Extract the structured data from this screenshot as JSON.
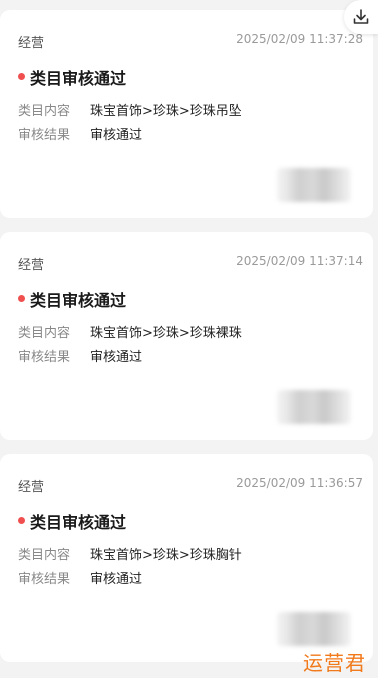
{
  "colors": {
    "status_dot": "#f04f4f",
    "watermark": "#f07a1c"
  },
  "download_button": {
    "icon": "download-icon"
  },
  "cards": [
    {
      "category": "经营",
      "timestamp": "2025/02/09 11:37:28",
      "title": "类目审核通过",
      "rows": [
        {
          "label": "类目内容",
          "value": "珠宝首饰>珍珠>珍珠吊坠"
        },
        {
          "label": "审核结果",
          "value": "审核通过"
        }
      ]
    },
    {
      "category": "经营",
      "timestamp": "2025/02/09 11:37:14",
      "title": "类目审核通过",
      "rows": [
        {
          "label": "类目内容",
          "value": "珠宝首饰>珍珠>珍珠裸珠"
        },
        {
          "label": "审核结果",
          "value": "审核通过"
        }
      ]
    },
    {
      "category": "经营",
      "timestamp": "2025/02/09 11:36:57",
      "title": "类目审核通过",
      "rows": [
        {
          "label": "类目内容",
          "value": "珠宝首饰>珍珠>珍珠胸针"
        },
        {
          "label": "审核结果",
          "value": "审核通过"
        }
      ]
    }
  ],
  "watermark": "运营君"
}
